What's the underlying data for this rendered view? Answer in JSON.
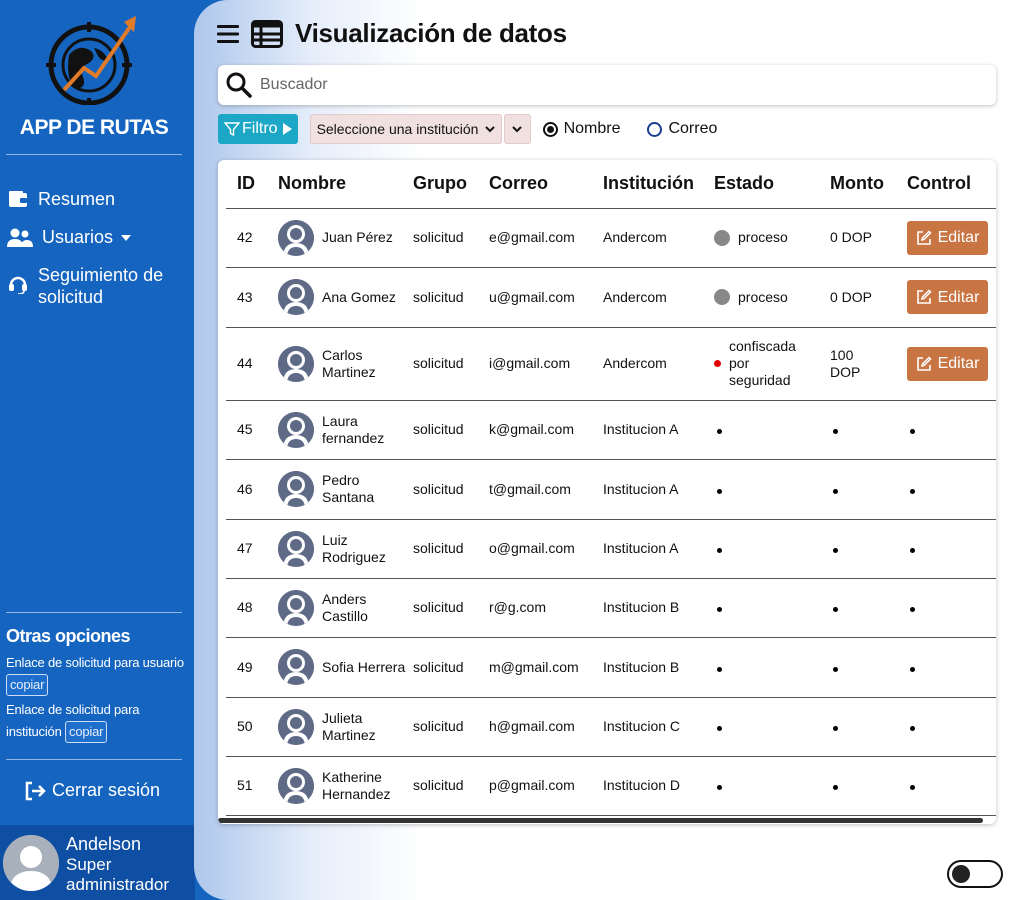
{
  "sidebar": {
    "app_title": "APP DE RUTAS",
    "logo_icon": "globe-compass-logo",
    "nav": [
      {
        "label": "Resumen",
        "icon": "wallet-icon"
      },
      {
        "label": "Usuarios",
        "icon": "users-icon"
      },
      {
        "label": "Seguimiento de solicitud",
        "icon": "headset-icon"
      }
    ],
    "other_options_title": "Otras opciones",
    "links": [
      {
        "text": "Enlace de solicitud para usuario",
        "button": "copiar"
      },
      {
        "text": "Enlace de solicitud para institución",
        "button": "copiar"
      }
    ],
    "logout_label": "Cerrar sesión",
    "user": {
      "name": "Andelson",
      "role": "Super administrador"
    }
  },
  "header": {
    "title": "Visualización de datos"
  },
  "search": {
    "placeholder": "Buscador"
  },
  "filters": {
    "filter_button": "Filtro",
    "institution_select": "Seleccione una institución",
    "radio_nombre": "Nombre",
    "radio_correo": "Correo",
    "selected_radio": "Nombre"
  },
  "table": {
    "headers": [
      "ID",
      "Nombre",
      "Grupo",
      "Correo",
      "Institución",
      "Estado",
      "Monto",
      "Control"
    ],
    "rows": [
      {
        "id": "42",
        "name": "Juan Pérez",
        "group": "solicitud",
        "email": "e@gmail.com",
        "institution": "Andercom",
        "status": "proceso",
        "status_type": "gray",
        "amount": "0 DOP",
        "control": "Editar"
      },
      {
        "id": "43",
        "name": "Ana Gomez",
        "group": "solicitud",
        "email": "u@gmail.com",
        "institution": "Andercom",
        "status": "proceso",
        "status_type": "gray",
        "amount": "0 DOP",
        "control": "Editar"
      },
      {
        "id": "44",
        "name": "Carlos Martinez",
        "group": "solicitud",
        "email": "i@gmail.com",
        "institution": "Andercom",
        "status": "confiscada por seguridad",
        "status_type": "red",
        "amount": "100 DOP",
        "control": "Editar"
      },
      {
        "id": "45",
        "name": "Laura fernandez",
        "group": "solicitud",
        "email": "k@gmail.com",
        "institution": "Institucion A",
        "status": "",
        "status_type": "none",
        "amount": "",
        "control": ""
      },
      {
        "id": "46",
        "name": "Pedro Santana",
        "group": "solicitud",
        "email": "t@gmail.com",
        "institution": "Institucion A",
        "status": "",
        "status_type": "none",
        "amount": "",
        "control": ""
      },
      {
        "id": "47",
        "name": "Luiz Rodriguez",
        "group": "solicitud",
        "email": "o@gmail.com",
        "institution": "Institucion A",
        "status": "",
        "status_type": "none",
        "amount": "",
        "control": ""
      },
      {
        "id": "48",
        "name": "Anders Castillo",
        "group": "solicitud",
        "email": "r@g.com",
        "institution": "Institucion B",
        "status": "",
        "status_type": "none",
        "amount": "",
        "control": ""
      },
      {
        "id": "49",
        "name": "Sofia Herrera",
        "group": "solicitud",
        "email": "m@gmail.com",
        "institution": "Institucion B",
        "status": "",
        "status_type": "none",
        "amount": "",
        "control": ""
      },
      {
        "id": "50",
        "name": "Julieta Martinez",
        "group": "solicitud",
        "email": "h@gmail.com",
        "institution": "Institucion C",
        "status": "",
        "status_type": "none",
        "amount": "",
        "control": ""
      },
      {
        "id": "51",
        "name": "Katherine Hernandez",
        "group": "solicitud",
        "email": "p@gmail.com",
        "institution": "Institucion D",
        "status": "",
        "status_type": "none",
        "amount": "",
        "control": ""
      }
    ]
  },
  "theme": {
    "sidebar": "#1565c0",
    "filter_button": "#1ca7c7",
    "edit_button": "#c87543",
    "status_gray": "#888888",
    "status_red": "#e00000"
  },
  "dark_mode_toggle": {
    "on": false
  }
}
